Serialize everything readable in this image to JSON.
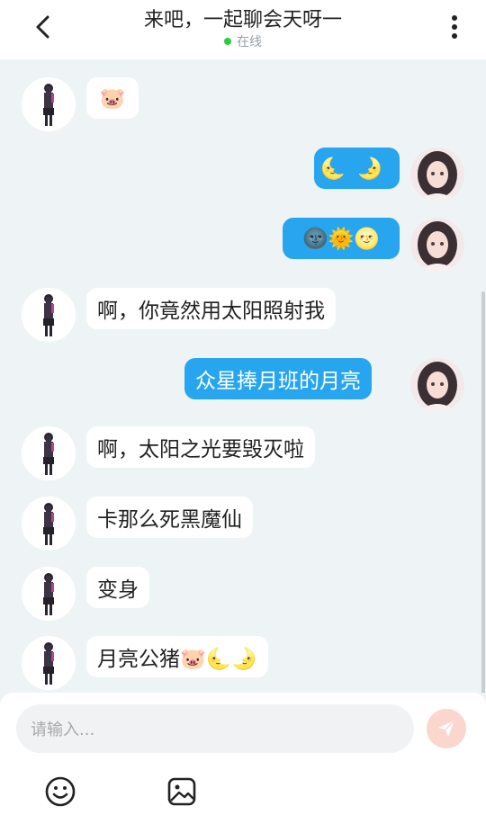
{
  "header": {
    "title": "来吧，一起聊会天呀一",
    "status": "在线"
  },
  "messages": [
    {
      "side": "left",
      "text": "🐷"
    },
    {
      "side": "right",
      "text": "🌜🌛"
    },
    {
      "side": "right",
      "text": "🌚🌞🌝"
    },
    {
      "side": "left",
      "text": "啊，你竟然用太阳照射我"
    },
    {
      "side": "right",
      "text": "众星捧月班的月亮"
    },
    {
      "side": "left",
      "text": "啊，太阳之光要毁灭啦"
    },
    {
      "side": "left",
      "text": "卡那么死黑魔仙"
    },
    {
      "side": "left",
      "text": "变身"
    },
    {
      "side": "left",
      "text": "月亮公猪🐷🌜🌛"
    }
  ],
  "composer": {
    "placeholder": "请输入..."
  },
  "icons": {
    "back": "chevron-left-icon",
    "menu": "more-vertical-icon",
    "send": "send-icon",
    "emoji": "smiley-icon",
    "image": "image-icon"
  },
  "colors": {
    "outgoing_bubble": "#27a6ef",
    "online_dot": "#2ecc40",
    "send_button": "#fbd6cf"
  }
}
